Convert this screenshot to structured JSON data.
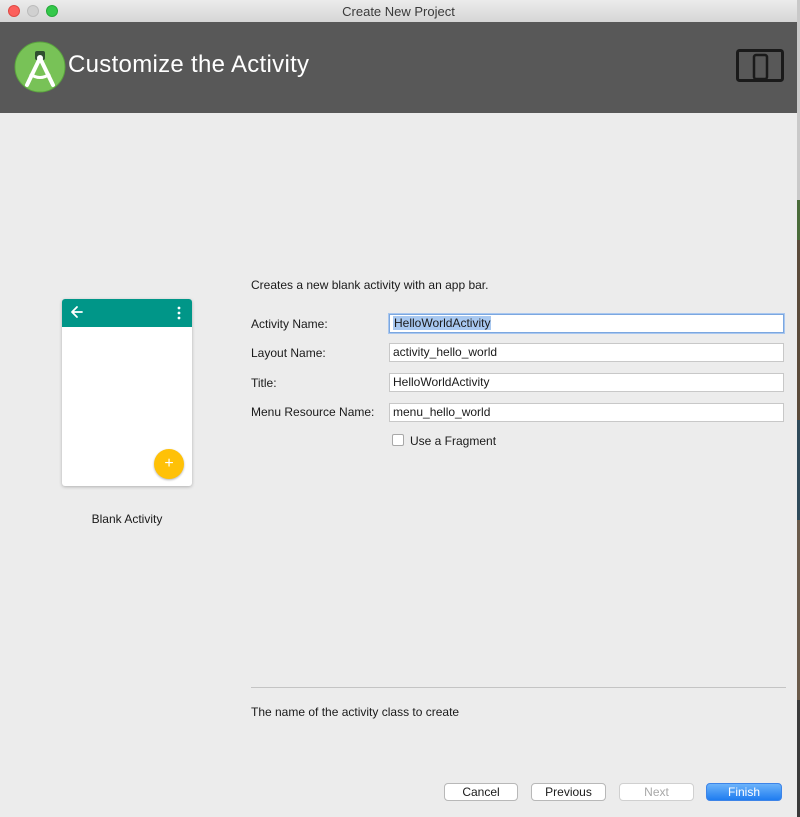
{
  "window": {
    "title": "Create New Project"
  },
  "header": {
    "title": "Customize the Activity",
    "logo_icon": "android-studio-logo-icon",
    "device_icon": "form-factor-devices-icon",
    "background_color": "#585858"
  },
  "preview": {
    "label": "Blank Activity",
    "appbar_color": "#009688",
    "fab_color": "#ffc107",
    "fab_glyph": "+"
  },
  "form": {
    "description": "Creates a new blank activity with an app bar.",
    "fields": [
      {
        "label": "Activity Name:",
        "value": "HelloWorldActivity"
      },
      {
        "label": "Layout Name:",
        "value": "activity_hello_world"
      },
      {
        "label": "Title:",
        "value": "HelloWorldActivity"
      },
      {
        "label": "Menu Resource Name:",
        "value": "menu_hello_world"
      }
    ],
    "fragment_checkbox": {
      "label": "Use a Fragment",
      "checked": false
    }
  },
  "help": {
    "text": "The name of the activity class to create"
  },
  "buttons": {
    "cancel": "Cancel",
    "previous": "Previous",
    "next": "Next",
    "finish": "Finish"
  },
  "colors": {
    "accent": "#1f7cf0",
    "selection": "#a8c8f0"
  }
}
